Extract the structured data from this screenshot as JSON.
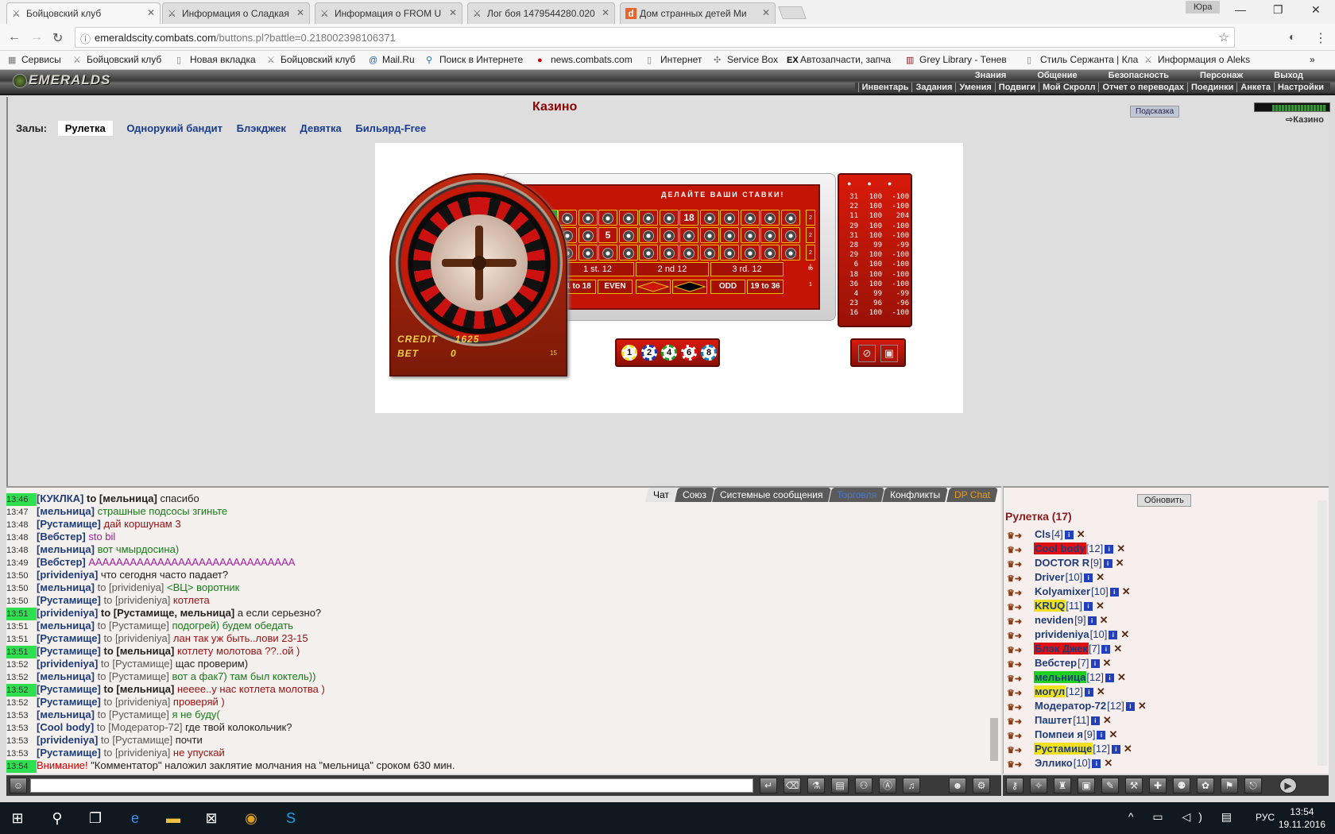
{
  "browser": {
    "tabs": [
      {
        "title": "Бойцовский клуб",
        "icon": "crossed-swords-icon",
        "active": true
      },
      {
        "title": "Информация о Сладкая",
        "icon": "crossed-swords-icon"
      },
      {
        "title": "Информация о FROM U",
        "icon": "crossed-swords-icon"
      },
      {
        "title": "Лог боя 1479544280.020",
        "icon": "crossed-swords-icon"
      },
      {
        "title": "Дом странных детей Ми",
        "icon": "d-icon"
      }
    ],
    "profile": "Юра",
    "url_host": "emeraldscity.combats.com",
    "url_path": "/buttons.pl?battle=0.218002398106371",
    "bookmarks": [
      "Сервисы",
      "Бойцовский клуб",
      "Новая вкладка",
      "Бойцовский клуб",
      "Mail.Ru",
      "Поиск в Интернете",
      "news.combats.com",
      "Интернет",
      "Service Box",
      "Автозапчасти, запча",
      "Grey Library - Тенев",
      "Стиль Сержанта | Кла",
      "Информация о Aleks"
    ]
  },
  "game": {
    "logo": "EMERALDS",
    "top_menu": [
      "Знания",
      "Общение",
      "Безопасность",
      "Персонаж",
      "Выход"
    ],
    "sub_menu": [
      "Инвентарь",
      "Задания",
      "Умения",
      "Подвиги",
      "Мой Скролл",
      "Отчет о переводах",
      "Поединки",
      "Анкета",
      "Настройки"
    ],
    "title": "Казино",
    "hint_button": "Подсказка",
    "location": "Казино",
    "halls_label": "Залы:",
    "halls": [
      "Рулетка",
      "Однорукий бандит",
      "Блэкджек",
      "Девятка",
      "Бильярд-Free"
    ],
    "selected_hall": "Рулетка",
    "roulette": {
      "bets_title": "ДЕЛАЙТЕ ВАШИ СТАВКИ!",
      "credit_label": "CREDIT",
      "credit_value": "1625",
      "bet_label": "BET",
      "bet_value": "0",
      "small_value": "15",
      "dozens": [
        "1 st. 12",
        "2 nd 12",
        "3 rd. 12"
      ],
      "outside": [
        "1 to 18",
        "EVEN",
        "ODD",
        "19 to 36"
      ],
      "column_bets": [
        "2 to 1",
        "2 to 1",
        "2 to 1"
      ],
      "big_numbers": [
        "18",
        "5"
      ],
      "chips": [
        "1",
        "2",
        "4",
        "6",
        "8"
      ],
      "history": [
        [
          "31",
          "100",
          "-100"
        ],
        [
          "22",
          "100",
          "-100"
        ],
        [
          "11",
          "100",
          "204"
        ],
        [
          "29",
          "100",
          "-100"
        ],
        [
          "31",
          "100",
          "-100"
        ],
        [
          "28",
          "99",
          "-99"
        ],
        [
          "29",
          "100",
          "-100"
        ],
        [
          "6",
          "100",
          "-100"
        ],
        [
          "18",
          "100",
          "-100"
        ],
        [
          "36",
          "100",
          "-100"
        ],
        [
          "4",
          "99",
          "-99"
        ],
        [
          "23",
          "96",
          "-96"
        ],
        [
          "16",
          "100",
          "-100"
        ]
      ]
    }
  },
  "chat": {
    "tabs": [
      "Чат",
      "Союз",
      "Системные сообщения",
      "Торговля",
      "Конфликты",
      "DP Chat"
    ],
    "lines": [
      {
        "t": "13:46",
        "hl": true,
        "nick": "[КУКЛКА]",
        "to": "to [мельница]",
        "tob": true,
        "msg": "спасибо",
        "c": ""
      },
      {
        "t": "13:47",
        "nick": "[мельница]",
        "to": "",
        "msg": "страшные подсосы згиньте",
        "c": "green"
      },
      {
        "t": "13:48",
        "nick": "[Рустамище]",
        "to": "",
        "msg": "дай коршунам 3",
        "c": "red"
      },
      {
        "t": "13:48",
        "nick": "[Вебстер]",
        "to": "",
        "msg": "sto bil",
        "c": "purple"
      },
      {
        "t": "13:48",
        "nick": "[мельница]",
        "to": "",
        "msg": "вот чмырдосина)",
        "c": "green"
      },
      {
        "t": "13:49",
        "nick": "[Вебстер]",
        "to": "",
        "msg": "АААААААААААААААААААААААААААААА",
        "c": "purple"
      },
      {
        "t": "13:50",
        "nick": "[privideniya]",
        "to": "",
        "msg": "что сегодня часто падает?",
        "c": ""
      },
      {
        "t": "13:50",
        "nick": "[мельница]",
        "to": "to [privideniya]",
        "msg": "<ВЦ> воротник",
        "c": "green"
      },
      {
        "t": "13:50",
        "nick": "[Рустамище]",
        "to": "to [privideniya]",
        "msg": "котлета",
        "c": "red"
      },
      {
        "t": "13:51",
        "hl": true,
        "nick": "[privideniya]",
        "to": "to [Рустамище, мельница]",
        "tob": true,
        "msg": "а если серьезно?",
        "c": ""
      },
      {
        "t": "13:51",
        "nick": "[мельница]",
        "to": "to [Рустамище]",
        "msg": "подогрей) будем обедать",
        "c": "green"
      },
      {
        "t": "13:51",
        "nick": "[Рустамище]",
        "to": "to [privideniya]",
        "msg": "лан так уж быть..лови 23-15",
        "c": "red"
      },
      {
        "t": "13:51",
        "hl": true,
        "nick": "[Рустамище]",
        "to": "to [мельница]",
        "tob": true,
        "msg": "котлету молотова ??..ой )",
        "c": "red"
      },
      {
        "t": "13:52",
        "nick": "[privideniya]",
        "to": "to [Рустамище]",
        "msg": "щас проверим)",
        "c": ""
      },
      {
        "t": "13:52",
        "nick": "[мельница]",
        "to": "to [Рустамище]",
        "msg": "вот а фак7) там был коктель))",
        "c": "green"
      },
      {
        "t": "13:52",
        "hl": true,
        "nick": "[Рустамище]",
        "to": "to [мельница]",
        "tob": true,
        "msg": "нееее..у нас котлета молотва )",
        "c": "red"
      },
      {
        "t": "13:52",
        "nick": "[Рустамище]",
        "to": "to [privideniya]",
        "msg": "проверяй )",
        "c": "red"
      },
      {
        "t": "13:53",
        "nick": "[мельница]",
        "to": "to [Рустамище]",
        "msg": "я не буду(",
        "c": "green"
      },
      {
        "t": "13:53",
        "nick": "[Cool body]",
        "to": "to [Модератор-72]",
        "msg": "где твой колокольчик?",
        "c": ""
      },
      {
        "t": "13:53",
        "nick": "[privideniya]",
        "to": "to [Рустамище]",
        "msg": "почти",
        "c": ""
      },
      {
        "t": "13:53",
        "nick": "[Рустамище]",
        "to": "to [privideniya]",
        "msg": "не упускай",
        "c": "red"
      },
      {
        "t": "13:54",
        "hl": true,
        "warn": "Внимание!",
        "msg": "\"Комментатор\" наложил заклятие молчания на \"мельница\" сроком 630 мин.",
        "c": "warnmsg"
      }
    ]
  },
  "online": {
    "refresh": "Обновить",
    "title": "Рулетка (17)",
    "users": [
      {
        "name": "Cls",
        "lvl": "[4]"
      },
      {
        "name": "Cool body",
        "lvl": "[12]",
        "bg": "#e01010"
      },
      {
        "name": "DOCTOR R",
        "lvl": "[9]"
      },
      {
        "name": "Driver",
        "lvl": "[10]"
      },
      {
        "name": "Kolyamixer",
        "lvl": "[10]"
      },
      {
        "name": "KRUQ",
        "lvl": "[11]",
        "bg": "#f0e020"
      },
      {
        "name": "neviden",
        "lvl": "[9]"
      },
      {
        "name": "privideniya",
        "lvl": "[10]"
      },
      {
        "name": "Блэк Джек",
        "lvl": "[7]",
        "bg": "#e01010"
      },
      {
        "name": "Вебстер",
        "lvl": "[7]"
      },
      {
        "name": "мельница",
        "lvl": "[12]",
        "bg": "#20d020"
      },
      {
        "name": "могул",
        "lvl": "[12]",
        "bg": "#f0e020"
      },
      {
        "name": "Модератор-72",
        "lvl": "[12]"
      },
      {
        "name": "Паштет",
        "lvl": "[11]"
      },
      {
        "name": "Помпеи я",
        "lvl": "[9]"
      },
      {
        "name": "Рустамище",
        "lvl": "[12]",
        "bg": "#f0e020"
      },
      {
        "name": "Эллико",
        "lvl": "[10]"
      }
    ]
  },
  "taskbar": {
    "lang": "РУС",
    "time": "13:54",
    "date": "19.11.2016"
  }
}
